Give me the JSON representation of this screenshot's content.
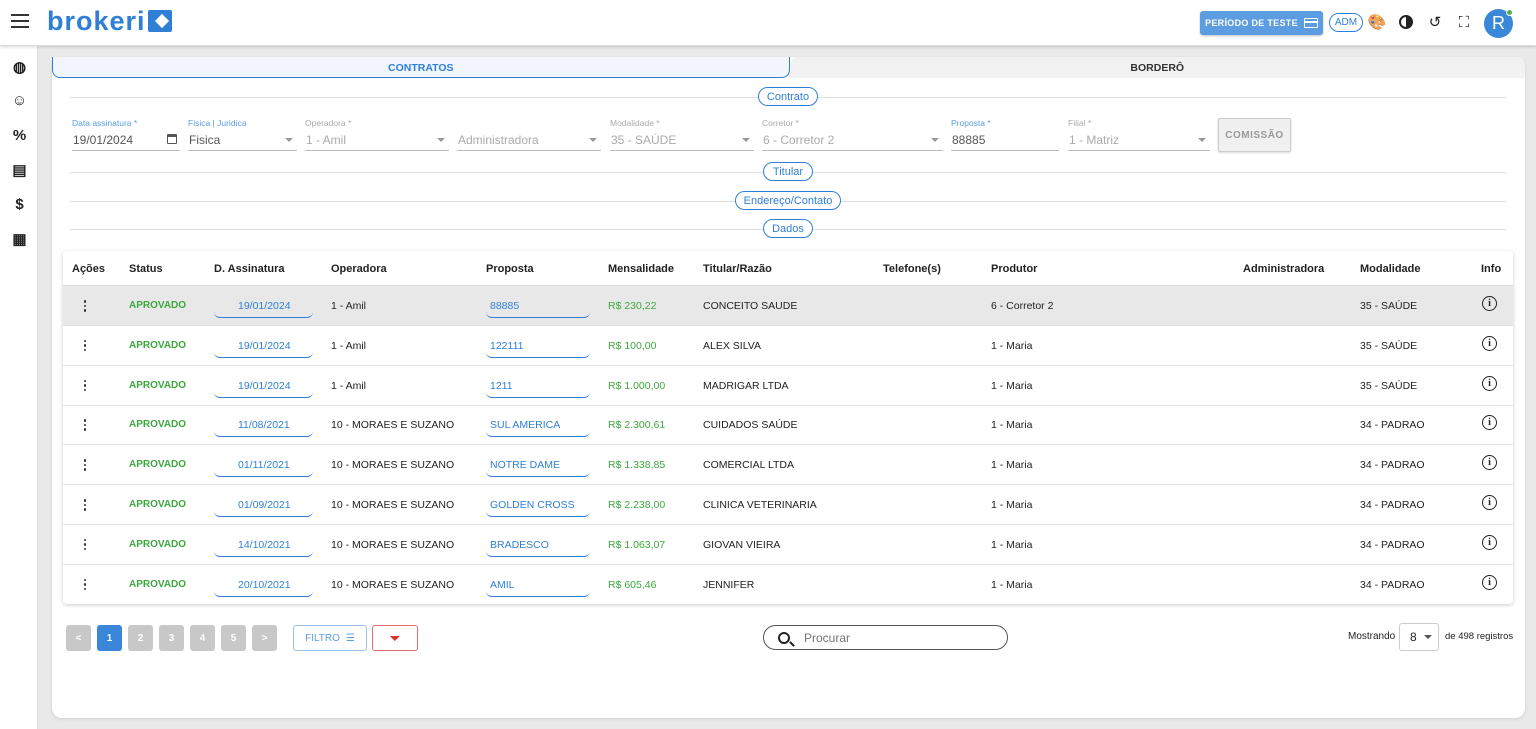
{
  "header": {
    "logo_text": "brokeri",
    "trial_button": "PERÍODO DE TESTE",
    "role_badge": "ADM",
    "avatar_initial": "R",
    "icons": [
      "menu-icon",
      "palette-icon",
      "contrast-icon",
      "reset-icon",
      "fullscreen-icon"
    ]
  },
  "sidenav": {
    "icons": [
      "dashboard-icon",
      "clients-icon",
      "percent-icon",
      "document-icon",
      "dollar-icon",
      "file-icon"
    ],
    "symbols": [
      "◍",
      "☺",
      "%",
      "▤",
      "$",
      "▦"
    ]
  },
  "tabs": [
    {
      "label": "CONTRATOS",
      "active": true
    },
    {
      "label": "BORDERÔ",
      "active": false
    }
  ],
  "sections": {
    "contrato": "Contrato",
    "titular": "Titular",
    "endereco": "Endereço/Contato",
    "dados": "Dados"
  },
  "form": {
    "data_assinatura": {
      "label": "Data assinatura *",
      "value": "19/01/2024"
    },
    "fisica_juridica": {
      "label": "Fisica | Juridica",
      "value": "Fisica"
    },
    "operadora": {
      "label": "Operadora *",
      "value": "1 - Amil"
    },
    "administradora": {
      "label": "",
      "value": "Administradora"
    },
    "modalidade": {
      "label": "Modalidade *",
      "value": "35 - SAÚDE"
    },
    "corretor": {
      "label": "Corretor *",
      "value": "6 - Corretor 2"
    },
    "proposta": {
      "label": "Proposta *",
      "value": "88885"
    },
    "filial": {
      "label": "Filial *",
      "value": "1 - Matriz"
    },
    "comissao_button": "COMISSÃO"
  },
  "table": {
    "columns": [
      "Ações",
      "Status",
      "D. Assinatura",
      "Operadora",
      "Proposta",
      "Mensalidade",
      "Titular/Razão",
      "Telefone(s)",
      "Produtor",
      "Administradora",
      "Modalidade",
      "Info"
    ],
    "rows": [
      {
        "status": "APROVADO",
        "data": "19/01/2024",
        "operadora": "1 - Amil",
        "proposta": "88885",
        "mensalidade": "R$ 230,22",
        "titular": "CONCEITO SAUDE",
        "telefone": "",
        "produtor": "6 - Corretor 2",
        "administradora": "",
        "modalidade": "35 - SAÚDE"
      },
      {
        "status": "APROVADO",
        "data": "19/01/2024",
        "operadora": "1 - Amil",
        "proposta": "122111",
        "mensalidade": "R$ 100,00",
        "titular": "ALEX SILVA",
        "telefone": "",
        "produtor": "1 - Maria",
        "administradora": "",
        "modalidade": "35 - SAÚDE"
      },
      {
        "status": "APROVADO",
        "data": "19/01/2024",
        "operadora": "1 - Amil",
        "proposta": "1211",
        "mensalidade": "R$ 1.000,00",
        "titular": "MADRIGAR LTDA",
        "telefone": "",
        "produtor": "1 - Maria",
        "administradora": "",
        "modalidade": "35 - SAÚDE"
      },
      {
        "status": "APROVADO",
        "data": "11/08/2021",
        "operadora": "10 - MORAES E SUZANO",
        "proposta": "SUL AMERICA",
        "mensalidade": "R$ 2.300,61",
        "titular": "CUIDADOS SAÚDE",
        "telefone": "",
        "produtor": "1 - Maria",
        "administradora": "",
        "modalidade": "34 - PADRAO"
      },
      {
        "status": "APROVADO",
        "data": "01/11/2021",
        "operadora": "10 - MORAES E SUZANO",
        "proposta": "NOTRE DAME",
        "mensalidade": "R$ 1.338,85",
        "titular": "COMERCIAL LTDA",
        "telefone": "",
        "produtor": "1 - Maria",
        "administradora": "",
        "modalidade": "34 - PADRAO"
      },
      {
        "status": "APROVADO",
        "data": "01/09/2021",
        "operadora": "10 - MORAES E SUZANO",
        "proposta": "GOLDEN CROSS",
        "mensalidade": "R$ 2.238,00",
        "titular": "CLINICA VETERINARIA",
        "telefone": "",
        "produtor": "1 - Maria",
        "administradora": "",
        "modalidade": "34 - PADRAO"
      },
      {
        "status": "APROVADO",
        "data": "14/10/2021",
        "operadora": "10 - MORAES E SUZANO",
        "proposta": "BRADESCO",
        "mensalidade": "R$ 1.063,07",
        "titular": "GIOVAN VIEIRA",
        "telefone": "",
        "produtor": "1 - Maria",
        "administradora": "",
        "modalidade": "34 - PADRAO"
      },
      {
        "status": "APROVADO",
        "data": "20/10/2021",
        "operadora": "10 - MORAES E SUZANO",
        "proposta": "AMIL",
        "mensalidade": "R$ 605,46",
        "titular": "JENNIFER",
        "telefone": "",
        "produtor": "1 - Maria",
        "administradora": "",
        "modalidade": "34 - PADRAO"
      }
    ]
  },
  "footer": {
    "pagination": [
      "<",
      "1",
      "2",
      "3",
      "4",
      "5",
      ">"
    ],
    "current_page": "1",
    "filter_button": "FILTRO",
    "search_placeholder": "Procurar",
    "showing_label": "Mostrando",
    "per_page": "8",
    "total_label": "de 498 registros"
  },
  "colors": {
    "accent": "#2f7fd6",
    "status_green": "#3da83d",
    "danger": "#d33333"
  }
}
